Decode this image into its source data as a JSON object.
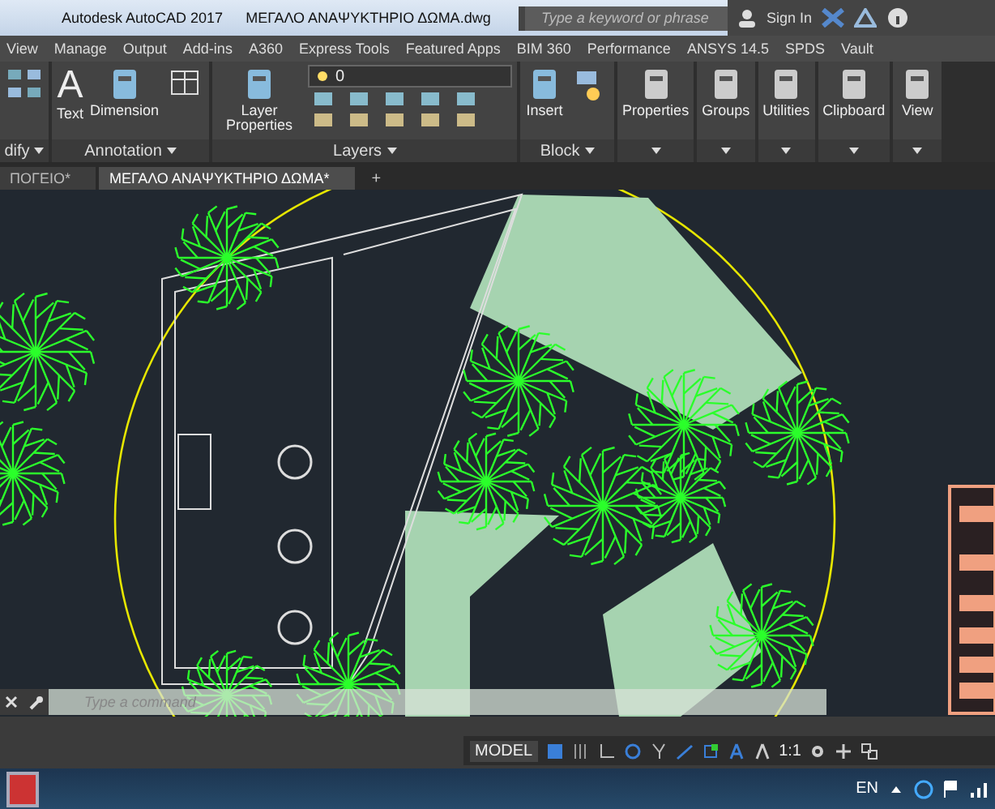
{
  "title_bar": {
    "app": "Autodesk AutoCAD 2017",
    "file": "ΜΕΓΑΛΟ ΑΝΑΨΥΚΤΗΡΙΟ ΔΩΜΑ.dwg",
    "search_placeholder": "Type a keyword or phrase",
    "sign_in": "Sign In"
  },
  "ribbon_tabs": [
    {
      "label": "View",
      "selected": false
    },
    {
      "label": "Manage",
      "selected": false
    },
    {
      "label": "Output",
      "selected": false
    },
    {
      "label": "Add-ins",
      "selected": false
    },
    {
      "label": "A360",
      "selected": false
    },
    {
      "label": "Express Tools",
      "selected": false
    },
    {
      "label": "Featured Apps",
      "selected": false
    },
    {
      "label": "BIM 360",
      "selected": false
    },
    {
      "label": "Performance",
      "selected": false
    },
    {
      "label": "ANSYS 14.5",
      "selected": false
    },
    {
      "label": "SPDS",
      "selected": false
    },
    {
      "label": "Vault",
      "selected": false
    }
  ],
  "ribbon_panels": [
    {
      "kind": "modify",
      "title": "dify"
    },
    {
      "kind": "annotation",
      "title": "Annotation",
      "buttons": [
        {
          "label": "Text",
          "glyph": "A"
        },
        {
          "label": "Dimension"
        }
      ]
    },
    {
      "kind": "layers",
      "title": "Layers",
      "layer": "0",
      "buttons": [
        {
          "label": "Layer Properties"
        }
      ]
    },
    {
      "kind": "block",
      "title": "Block",
      "buttons": [
        {
          "label": "Insert"
        }
      ]
    },
    {
      "kind": "tool",
      "buttons": [
        {
          "label": "Properties"
        }
      ]
    },
    {
      "kind": "tool",
      "buttons": [
        {
          "label": "Groups"
        }
      ]
    },
    {
      "kind": "tool",
      "buttons": [
        {
          "label": "Utilities"
        }
      ]
    },
    {
      "kind": "tool",
      "buttons": [
        {
          "label": "Clipboard"
        }
      ]
    },
    {
      "kind": "tool",
      "buttons": [
        {
          "label": "View"
        }
      ]
    }
  ],
  "file_tabs": [
    {
      "label": "ΠΟΓΕΙΟ*",
      "selected": false
    },
    {
      "label": "ΜΕΓΑΛΟ ΑΝΑΨΥΚΤΗΡΙΟ ΔΩΜΑ*",
      "selected": true
    }
  ],
  "new_tab": "+",
  "command_line": {
    "placeholder": "Type a command"
  },
  "status_bar": {
    "model": "MODEL",
    "scale": "1:1"
  },
  "taskbar": {
    "language": "EN"
  }
}
